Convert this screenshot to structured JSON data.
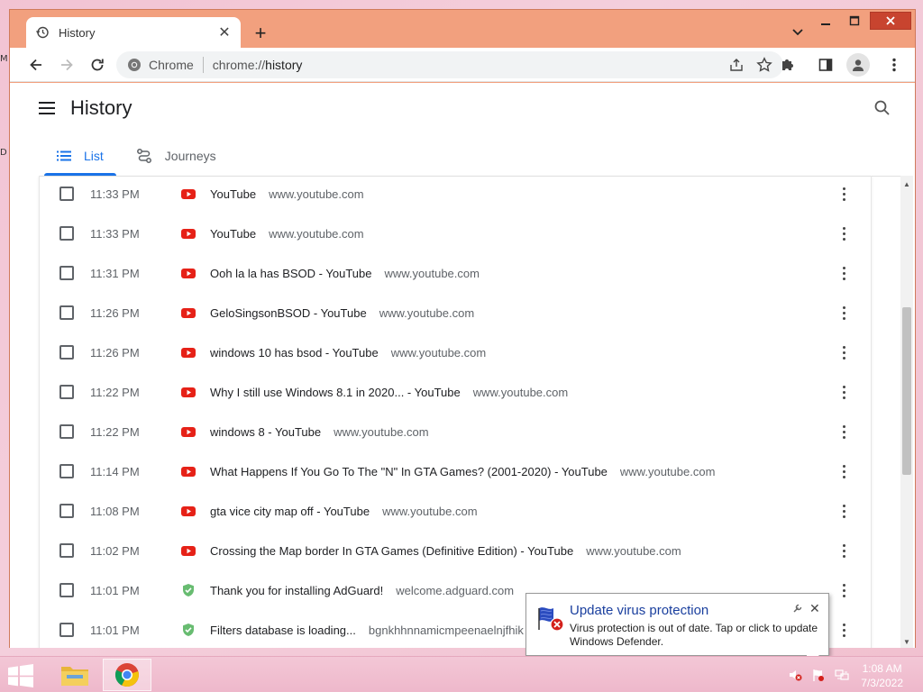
{
  "desktop": {
    "edge_chars": [
      "M",
      "D"
    ]
  },
  "browser": {
    "tab": {
      "title": "History"
    },
    "omnibox": {
      "site_label": "Chrome",
      "url_scheme": "chrome://",
      "url_path": "history"
    },
    "accent": "#1a73e8",
    "frame_color": "#f2a07e"
  },
  "history": {
    "title": "History",
    "tabs": [
      {
        "label": "List",
        "icon": "list-icon",
        "active": true
      },
      {
        "label": "Journeys",
        "icon": "journeys-icon",
        "active": false
      }
    ],
    "rows": [
      {
        "time": "11:33 PM",
        "title": "YouTube",
        "domain": "www.youtube.com",
        "icon": "youtube-icon"
      },
      {
        "time": "11:33 PM",
        "title": "YouTube",
        "domain": "www.youtube.com",
        "icon": "youtube-icon"
      },
      {
        "time": "11:31 PM",
        "title": "Ooh la la has BSOD - YouTube",
        "domain": "www.youtube.com",
        "icon": "youtube-icon"
      },
      {
        "time": "11:26 PM",
        "title": "GeloSingsonBSOD - YouTube",
        "domain": "www.youtube.com",
        "icon": "youtube-icon"
      },
      {
        "time": "11:26 PM",
        "title": "windows 10 has bsod - YouTube",
        "domain": "www.youtube.com",
        "icon": "youtube-icon"
      },
      {
        "time": "11:22 PM",
        "title": "Why I still use Windows 8.1 in 2020... - YouTube",
        "domain": "www.youtube.com",
        "icon": "youtube-icon"
      },
      {
        "time": "11:22 PM",
        "title": "windows 8 - YouTube",
        "domain": "www.youtube.com",
        "icon": "youtube-icon"
      },
      {
        "time": "11:14 PM",
        "title": "What Happens If You Go To The \"N\" In GTA Games? (2001-2020) - YouTube",
        "domain": "www.youtube.com",
        "icon": "youtube-icon"
      },
      {
        "time": "11:08 PM",
        "title": "gta vice city map off - YouTube",
        "domain": "www.youtube.com",
        "icon": "youtube-icon"
      },
      {
        "time": "11:02 PM",
        "title": "Crossing the Map border In GTA Games (Definitive Edition) - YouTube",
        "domain": "www.youtube.com",
        "icon": "youtube-icon"
      },
      {
        "time": "11:01 PM",
        "title": "Thank you for installing AdGuard!",
        "domain": "welcome.adguard.com",
        "icon": "adguard-shield-icon"
      },
      {
        "time": "11:01 PM",
        "title": "Filters database is loading...",
        "domain": "bgnkhhnnamicmpeenaelnjfhik",
        "icon": "adguard-shield-icon"
      }
    ]
  },
  "notification": {
    "title": "Update virus protection",
    "message": "Virus protection is out of date. Tap or click to update Windows Defender."
  },
  "taskbar": {
    "clock_time": "1:08 AM",
    "clock_date": "7/3/2022"
  }
}
